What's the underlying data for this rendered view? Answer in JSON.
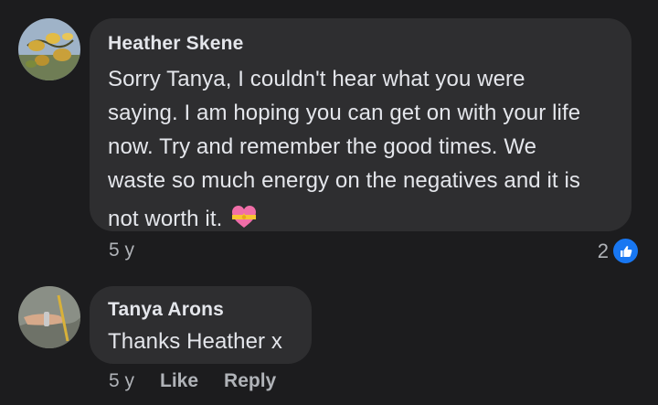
{
  "comments": [
    {
      "author": "Heather Skene",
      "avatar_icon": "avatar-yellow-flowers",
      "text_lines": [
        "Sorry Tanya, I couldn't hear what you were",
        "saying. I am hoping you can get on with your life",
        "now. Try and remember the good times. We",
        "waste so much energy on the negatives and it is",
        "not worth it."
      ],
      "emoji": "heart-with-ribbon-emoji",
      "time": "5 y",
      "reaction_count": "2",
      "reaction_icon": "like-icon"
    },
    {
      "author": "Tanya Arons",
      "avatar_icon": "avatar-hand-with-bracelet",
      "text": "Thanks Heather x",
      "time": "5 y",
      "like_label": "Like",
      "reply_label": "Reply"
    }
  ],
  "colors": {
    "background": "#1c1c1e",
    "bubble": "#2e2e30",
    "text": "#e4e6eb",
    "meta": "#b0b3b8",
    "like_blue": "#1877f2"
  }
}
